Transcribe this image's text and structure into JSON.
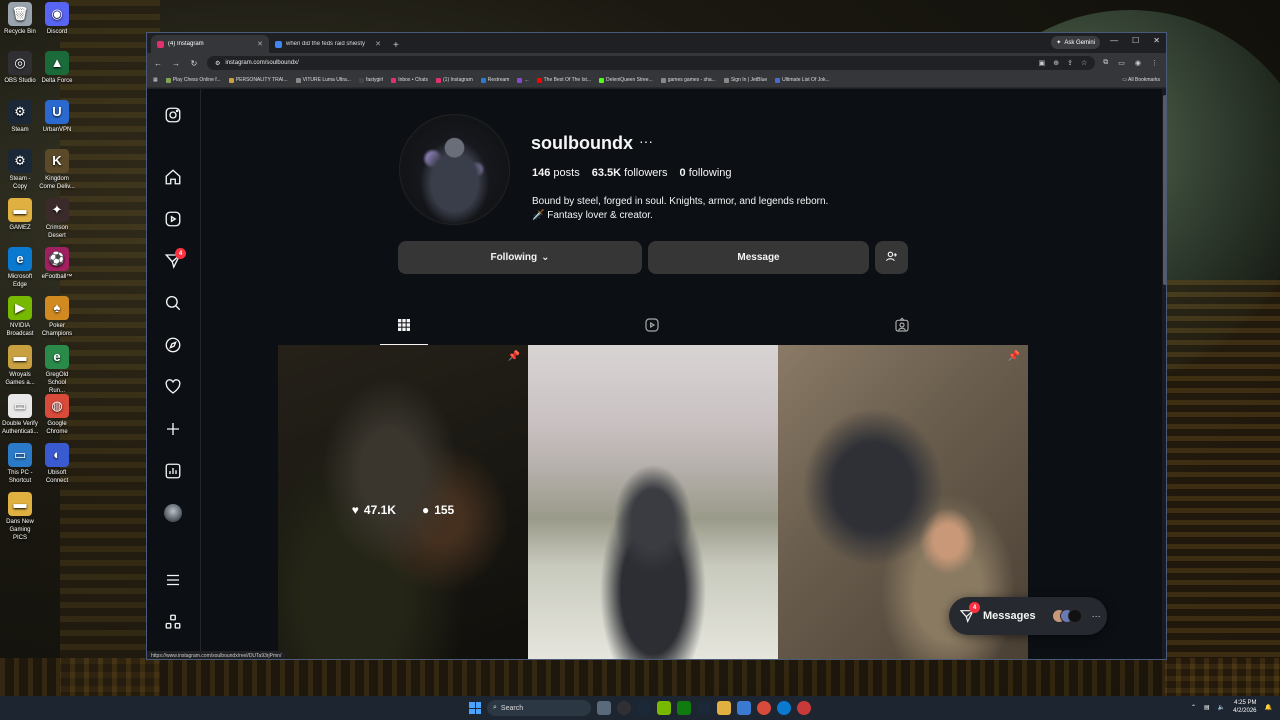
{
  "desktop": {
    "icons": [
      {
        "label": "Recycle Bin",
        "color": "#9aa4ae",
        "glyph": "🗑"
      },
      {
        "label": "Discord",
        "color": "#5865f2",
        "glyph": "◉"
      },
      {
        "label": "OBS Studio",
        "color": "#303034",
        "glyph": "◎"
      },
      {
        "label": "Delta Force",
        "color": "#1a6a3a",
        "glyph": "▲"
      },
      {
        "label": "Steam",
        "color": "#1b2838",
        "glyph": "⚙"
      },
      {
        "label": "UrbanVPN",
        "color": "#2a6ad0",
        "glyph": "U"
      },
      {
        "label": "Steam - Copy",
        "color": "#1b2838",
        "glyph": "⚙"
      },
      {
        "label": "Kingdom Come Deliv...",
        "color": "#5a4a2a",
        "glyph": "K"
      },
      {
        "label": "GAMEZ",
        "color": "#e0b040",
        "glyph": "▬"
      },
      {
        "label": "Crimson Desert",
        "color": "#3a2a2a",
        "glyph": "✦"
      },
      {
        "label": "Microsoft Edge",
        "color": "#0a7ad0",
        "glyph": "e"
      },
      {
        "label": "eFootball™",
        "color": "#a02060",
        "glyph": "⚽"
      },
      {
        "label": "NVIDIA Broadcast",
        "color": "#76b900",
        "glyph": "▶"
      },
      {
        "label": "Poker Champions",
        "color": "#d08a20",
        "glyph": "♠"
      },
      {
        "label": "Wroyals Games a...",
        "color": "#c8a040",
        "glyph": "▬"
      },
      {
        "label": "GregOld School Run...",
        "color": "#2a8a4a",
        "glyph": "e"
      },
      {
        "label": "Double Verify Authenticati...",
        "color": "#e8e8e8",
        "glyph": "▭"
      },
      {
        "label": "Google Chrome",
        "color": "#d84a3a",
        "glyph": "◍"
      },
      {
        "label": "This PC - Shortcut",
        "color": "#2a7ac8",
        "glyph": "▭"
      },
      {
        "label": "Ubisoft Connect",
        "color": "#3a5ad0",
        "glyph": "◐"
      },
      {
        "label": "Dans New Gaming PICS",
        "color": "#e0b040",
        "glyph": "▬"
      }
    ]
  },
  "browser": {
    "tabs": [
      {
        "label": "(4) Instagram",
        "active": true,
        "color": "#e1306c"
      },
      {
        "label": "when did the feds raid shiesty",
        "active": false,
        "color": "#4285f4"
      }
    ],
    "new_tab": "+",
    "ask_gemini": "Ask Gemini",
    "window_controls": [
      "—",
      "☐",
      "✕"
    ],
    "url": "instagram.com/soulboundx/",
    "bookmarks": [
      {
        "label": "Play Chess Online f...",
        "color": "#7fa650"
      },
      {
        "label": "PERSONALITY TRAI...",
        "color": "#c8a040"
      },
      {
        "label": "VITURE Luma Ultra...",
        "color": "#888888"
      },
      {
        "label": "fastygirl",
        "color": "#444444"
      },
      {
        "label": "Inbox • Chats",
        "color": "#e1306c"
      },
      {
        "label": "(1) Instagram",
        "color": "#e1306c"
      },
      {
        "label": "Restream",
        "color": "#2a7ad0"
      },
      {
        "label": "...",
        "color": "#8a4ad0"
      },
      {
        "label": "The Best Of The Ist...",
        "color": "#ff0000"
      },
      {
        "label": "DeleniQueen Stree...",
        "color": "#53fc18"
      },
      {
        "label": "games games - sha...",
        "color": "#888888"
      },
      {
        "label": "Sign In | JetBlue",
        "color": "#888888"
      },
      {
        "label": "Ultimate List Of Jok...",
        "color": "#4a6ad0"
      }
    ],
    "all_bookmarks": "All Bookmarks",
    "status_url": "https://www.instagram.com/soulboundx/reel/DUTa93rjPmn/"
  },
  "instagram": {
    "nav_badge": "4",
    "profile": {
      "username": "soulboundx",
      "more": "···",
      "posts_count": "146",
      "posts_label": "posts",
      "followers_count": "63.5K",
      "followers_label": "followers",
      "following_count": "0",
      "following_label": "following",
      "bio_line1": "Bound by steel, forged in soul. Knights, armor, and legends reborn.",
      "bio_line2": "🗡️ Fantasy lover & creator."
    },
    "buttons": {
      "following": "Following",
      "message": "Message"
    },
    "hover_post": {
      "likes": "47.1K",
      "comments": "155"
    },
    "messages": {
      "label": "Messages",
      "badge": "4",
      "more": "···"
    }
  },
  "taskbar": {
    "search": "Search",
    "time": "4:25 PM",
    "date": "4/2/2026"
  }
}
